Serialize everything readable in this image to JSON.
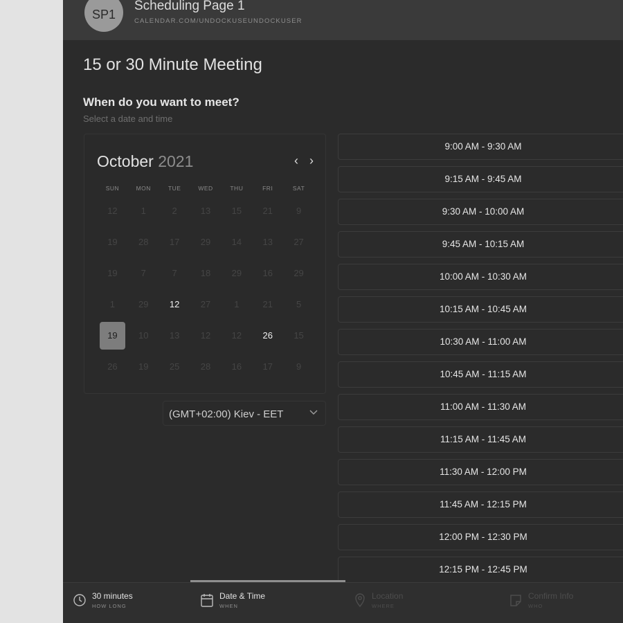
{
  "header": {
    "avatar_initials": "SP1",
    "page_name": "Scheduling Page 1",
    "page_url": "CALENDAR.COM/UNDOCKUSEUNDOCKUSER"
  },
  "event": {
    "title": "15 or 30 Minute Meeting",
    "question": "When do you want to meet?",
    "question_sub": "Select a date and time"
  },
  "calendar": {
    "month": "October",
    "year": "2021",
    "prev_icon": "chevron-left-icon",
    "next_icon": "chevron-right-icon",
    "weekdays": [
      "SUN",
      "MON",
      "TUE",
      "WED",
      "THU",
      "FRI",
      "SAT"
    ],
    "days": [
      [
        "12",
        "1",
        "2",
        "13",
        "15",
        "21",
        "9"
      ],
      [
        "19",
        "28",
        "17",
        "29",
        "14",
        "13",
        "27"
      ],
      [
        "19",
        "7",
        "7",
        "18",
        "29",
        "16",
        "29"
      ],
      [
        "1",
        "29",
        "12",
        "27",
        "1",
        "21",
        "5"
      ],
      [
        "19",
        "10",
        "13",
        "12",
        "12",
        "26",
        "15"
      ],
      [
        "26",
        "19",
        "25",
        "28",
        "16",
        "17",
        "9"
      ]
    ],
    "available": [
      [
        3,
        2
      ],
      [
        4,
        5
      ]
    ],
    "selected": [
      4,
      0
    ]
  },
  "timezone": {
    "value": "(GMT+02:00) Kiev - EET",
    "icon": "chevron-down-icon"
  },
  "slots": [
    "9:00 AM - 9:30 AM",
    "9:15 AM - 9:45 AM",
    "9:30 AM - 10:00 AM",
    "9:45 AM - 10:15 AM",
    "10:00 AM - 10:30 AM",
    "10:15 AM - 10:45 AM",
    "10:30 AM - 11:00 AM",
    "10:45 AM - 11:15 AM",
    "11:00 AM - 11:30 AM",
    "11:15 AM - 11:45 AM",
    "11:30 AM - 12:00 PM",
    "11:45 AM - 12:15 PM",
    "12:00 PM - 12:30 PM",
    "12:15 PM - 12:45 PM"
  ],
  "footer": {
    "steps": [
      {
        "label": "30 minutes",
        "sub": "HOW LONG",
        "icon": "clock-icon",
        "state": "done"
      },
      {
        "label": "Date & Time",
        "sub": "WHEN",
        "icon": "calendar-icon",
        "state": "active"
      },
      {
        "label": "Location",
        "sub": "WHERE",
        "icon": "location-pin-icon",
        "state": "disabled"
      },
      {
        "label": "Confirm Info",
        "sub": "WHO",
        "icon": "note-icon",
        "state": "disabled"
      }
    ]
  }
}
